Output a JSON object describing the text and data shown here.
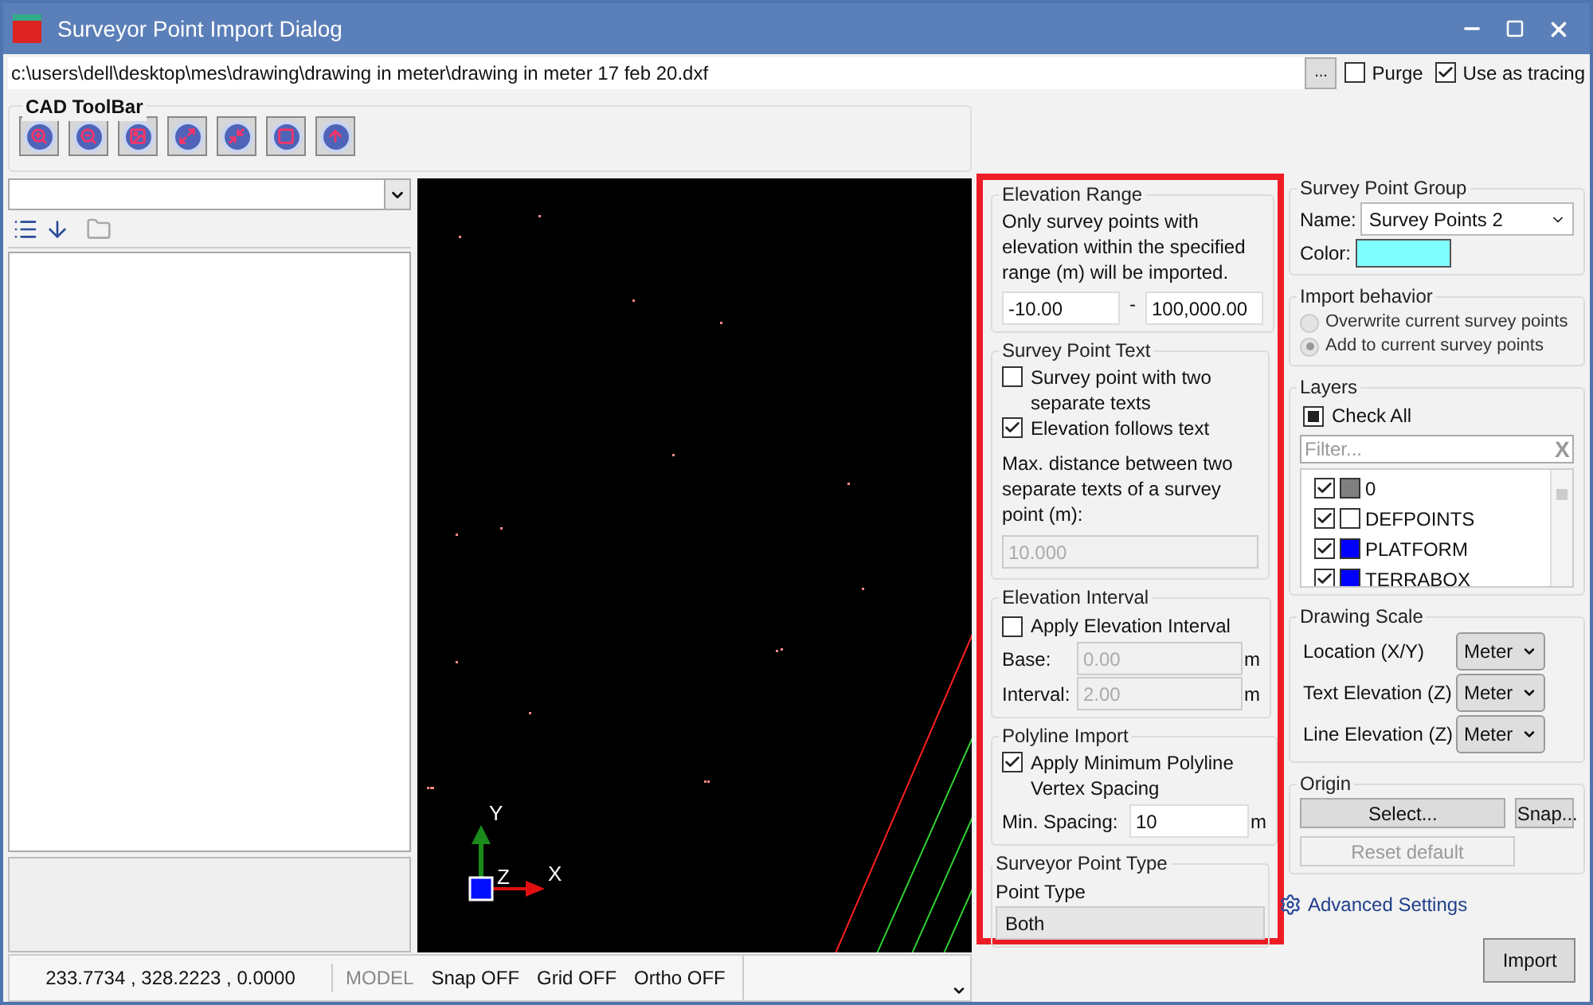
{
  "window": {
    "title": "Surveyor Point Import Dialog"
  },
  "file": {
    "path": "c:\\users\\dell\\desktop\\mes\\drawing\\drawing in meter\\drawing in meter 17 feb 20.dxf",
    "browse": "...",
    "purge": {
      "label": "Purge",
      "checked": false
    },
    "use_as_tracing": {
      "label": "Use as tracing",
      "checked": true
    }
  },
  "cad_toolbar": {
    "title": "CAD ToolBar"
  },
  "canvas": {
    "axis_labels": [
      "Y",
      "Z",
      "X"
    ]
  },
  "status_bar": {
    "coordinates": "233.7734 , 328.2223 , 0.0000",
    "mode": "MODEL",
    "snap": "Snap OFF",
    "grid": "Grid OFF",
    "ortho": "Ortho OFF"
  },
  "elevation_range": {
    "title": "Elevation Range",
    "description": "Only survey points with elevation within the specified range (m) will be imported.",
    "min": "-10.00",
    "separator": "-",
    "max": "100,000.00"
  },
  "survey_point_text": {
    "title": "Survey Point Text",
    "options": [
      {
        "label": "Survey point with two separate texts",
        "checked": false
      },
      {
        "label": "Elevation follows text",
        "checked": true
      }
    ],
    "distance_label": "Max. distance between two separate texts of a survey point (m):",
    "distance_value": "10.000",
    "distance_disabled": true
  },
  "elevation_interval": {
    "title": "Elevation Interval",
    "apply": {
      "label": "Apply Elevation Interval",
      "checked": false
    },
    "fields": [
      {
        "label": "Base:",
        "value": "0.00",
        "unit": "m",
        "disabled": true
      },
      {
        "label": "Interval:",
        "value": "2.00",
        "unit": "m",
        "disabled": true
      }
    ]
  },
  "polyline_import": {
    "title": "Polyline Import",
    "apply": {
      "label": "Apply Minimum Polyline Vertex Spacing",
      "checked": true
    },
    "min_spacing": {
      "label": "Min. Spacing:",
      "value": "10",
      "unit": "m",
      "disabled": false
    }
  },
  "surveyor_point_type": {
    "title": "Surveyor Point Type",
    "label": "Point Type",
    "value": "Both"
  },
  "survey_point_group": {
    "title": "Survey Point Group",
    "name_label": "Name:",
    "name_value": "Survey Points 2",
    "color_label": "Color:",
    "color": "#80ffff"
  },
  "import_behavior": {
    "title": "Import behavior",
    "options": [
      {
        "label": "Overwrite current survey points",
        "selected": false
      },
      {
        "label": "Add to current survey points",
        "selected": true
      }
    ]
  },
  "layers": {
    "title": "Layers",
    "check_all": {
      "label": "Check All",
      "indeterminate": true
    },
    "filter_placeholder": "Filter...",
    "clear": "X",
    "items": [
      {
        "name": "0",
        "checked": true,
        "color": "#808080"
      },
      {
        "name": "DEFPOINTS",
        "checked": true,
        "color": "#ffffff"
      },
      {
        "name": "PLATFORM",
        "checked": true,
        "color": "#0000ff"
      },
      {
        "name": "TERRABOX",
        "checked": true,
        "color": "#0000ff"
      }
    ]
  },
  "drawing_scale": {
    "title": "Drawing Scale",
    "rows": [
      {
        "label": "Location (X/Y)",
        "unit": "Meter"
      },
      {
        "label": "Text Elevation (Z)",
        "unit": "Meter"
      },
      {
        "label": "Line Elevation (Z)",
        "unit": "Meter"
      }
    ]
  },
  "origin": {
    "title": "Origin",
    "select": "Select...",
    "snap": "Snap...",
    "reset": "Reset default",
    "reset_disabled": true
  },
  "advanced_settings": "Advanced Settings",
  "import_button": "Import"
}
